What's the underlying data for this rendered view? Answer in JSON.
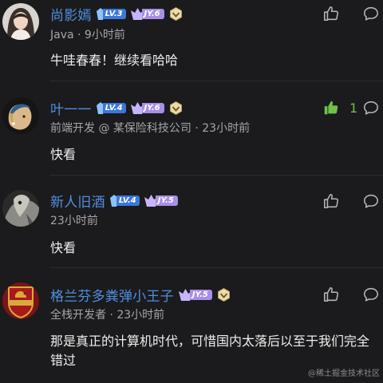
{
  "comments": [
    {
      "username": "尚影嫣",
      "level": "LV.3",
      "jy": "JY.6",
      "meta": "Java · 9小时前",
      "text": "牛哇春春！继续看哈哈",
      "likes": "",
      "liked": false
    },
    {
      "username": "叶一一",
      "level": "LV.4",
      "jy": "JY.6",
      "meta": "前端开发 @ 某保险科技公司 · 23小时前",
      "text": "快看",
      "likes": "1",
      "liked": true
    },
    {
      "username": "新人旧酒",
      "level": "LV.4",
      "jy": "JY.5",
      "meta": "23小时前",
      "text": "快看",
      "likes": "",
      "liked": false
    },
    {
      "username": "格兰芬多粪弹小王子",
      "level": "",
      "jy": "JY.5",
      "meta": "全栈开发者 · 23小时前",
      "text": "那是真正的计算机时代，可惜国内太落后以至于我们完全错过",
      "likes": "",
      "liked": false
    }
  ],
  "watermark": "@稀土掘金技术社区",
  "colors": {
    "background": "#1b1b1d",
    "username": "#4f8fe0",
    "level_badge": "#3b78d8",
    "jy_badge": "#a78ee6",
    "liked": "#6fc24a",
    "icon": "#b5b5b7"
  },
  "icons": [
    "thumbs-up-icon",
    "comment-bubble-icon",
    "verified-icon",
    "level-gem-icon",
    "jy-crown-icon"
  ]
}
